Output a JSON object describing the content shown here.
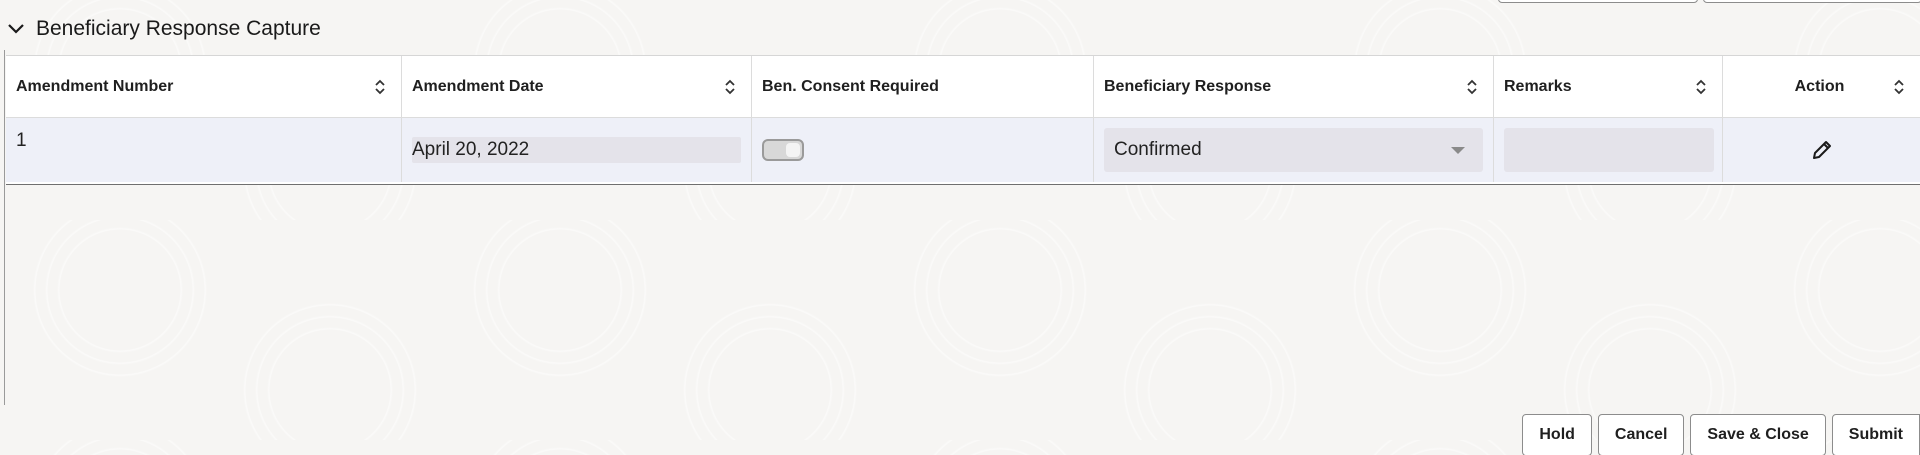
{
  "section": {
    "title": "Beneficiary Response Capture"
  },
  "table": {
    "columns": [
      "Amendment Number",
      "Amendment Date",
      "Ben. Consent Required",
      "Beneficiary Response",
      "Remarks",
      "Action"
    ],
    "rows": [
      {
        "amendment_number": "1",
        "amendment_date": "April 20, 2022",
        "ben_consent_required": false,
        "beneficiary_response": "Confirmed",
        "remarks": ""
      }
    ]
  },
  "footer": {
    "hold": "Hold",
    "cancel": "Cancel",
    "save_close": "Save & Close",
    "submit": "Submit"
  },
  "icons": {
    "section_toggle": "chevron-down-icon",
    "sort": "sort-icon",
    "dropdown": "caret-down-icon",
    "edit": "pencil-icon"
  },
  "colors": {
    "row_background": "#eef0f8",
    "field_background": "#e4e3ea"
  }
}
